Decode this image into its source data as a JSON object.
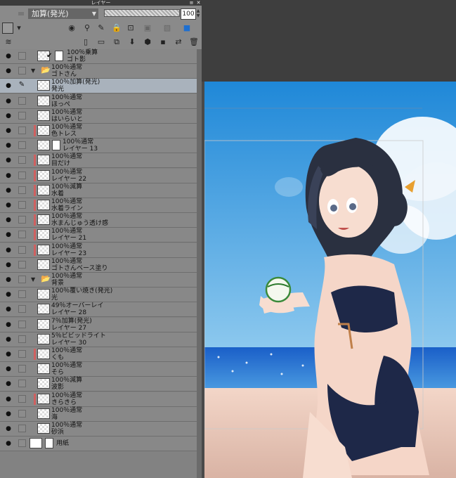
{
  "window": {
    "title": "レイヤー",
    "menu_icon": "menu-icon",
    "close_icon": "close-icon"
  },
  "blend_mode": {
    "selected": "加算(発光)"
  },
  "opacity": {
    "value": "100"
  },
  "colors": {
    "panel_bg": "#828282",
    "selected_row": "#a9b2bc",
    "clip_marker": "#d06060",
    "canvas_bg": "#4a4a4a"
  },
  "toolbar1": {
    "icons": [
      "color-swatch-icon",
      "dropdown-icon",
      "layer-stack-icon",
      "ruler-icon",
      "pen-lock-icon",
      "lock-icon",
      "alpha-lock-icon",
      "mask-icon",
      "mask-toggle-icon",
      "color-apply-icon"
    ]
  },
  "toolbar2": {
    "icons": [
      "new-layer-icon",
      "new-vector-icon",
      "new-folder-icon",
      "merge-down-icon",
      "clip-icon",
      "transfer-icon",
      "mask-add-icon",
      "delete-icon"
    ]
  },
  "layers": [
    {
      "line1": "100％乗算",
      "line2": "ゴト影",
      "type": "layer",
      "mask": true,
      "check": true
    },
    {
      "line1": "100％通常",
      "line2": "ゴトさん",
      "type": "folder"
    },
    {
      "line1": "100％加算(発光)",
      "line2": "発光",
      "type": "layer",
      "selected": true,
      "pen": true
    },
    {
      "line1": "100％通常",
      "line2": "ほっぺ",
      "type": "layer"
    },
    {
      "line1": "100％通常",
      "line2": "はいらいと",
      "type": "layer"
    },
    {
      "line1": "100％通常",
      "line2": "色トレス",
      "type": "layer",
      "clip": true
    },
    {
      "line1": "100％通常",
      "line2": "レイヤー 13",
      "type": "layer",
      "mask": true
    },
    {
      "line1": "100％通常",
      "line2": "目だけ",
      "type": "layer",
      "clip": true
    },
    {
      "line1": "100％通常",
      "line2": "レイヤー 22",
      "type": "layer",
      "clip": true
    },
    {
      "line1": "100％減算",
      "line2": "水着",
      "type": "layer",
      "clip": true
    },
    {
      "line1": "100％通常",
      "line2": "水着ライン",
      "type": "layer",
      "clip": true
    },
    {
      "line1": "100％通常",
      "line2": "水まんじゅう透け感",
      "type": "layer",
      "clip": true
    },
    {
      "line1": "100％通常",
      "line2": "レイヤー 21",
      "type": "layer",
      "clip": true
    },
    {
      "line1": "100％通常",
      "line2": "レイヤー 23",
      "type": "layer",
      "clip": true
    },
    {
      "line1": "100％通常",
      "line2": "ゴトさんベース塗り",
      "type": "layer"
    },
    {
      "line1": "100％通常",
      "line2": "背景",
      "type": "folder"
    },
    {
      "line1": "100％覆い焼き(発光)",
      "line2": "光",
      "type": "layer"
    },
    {
      "line1": "49％オーバーレイ",
      "line2": "レイヤー 28",
      "type": "layer"
    },
    {
      "line1": "7％加算(発光)",
      "line2": "レイヤー 27",
      "type": "layer"
    },
    {
      "line1": "5％ビビッドライト",
      "line2": "レイヤー 30",
      "type": "layer"
    },
    {
      "line1": "100％通常",
      "line2": "くも",
      "type": "layer",
      "clip": true
    },
    {
      "line1": "100％通常",
      "line2": "そら",
      "type": "layer"
    },
    {
      "line1": "100％減算",
      "line2": "波影",
      "type": "layer"
    },
    {
      "line1": "100％通常",
      "line2": "きらきら",
      "type": "layer",
      "clip": true
    },
    {
      "line1": "100％通常",
      "line2": "海",
      "type": "layer"
    },
    {
      "line1": "100％通常",
      "line2": "砂浜",
      "type": "layer"
    },
    {
      "line1": "",
      "line2": "用紙",
      "type": "paper"
    }
  ]
}
